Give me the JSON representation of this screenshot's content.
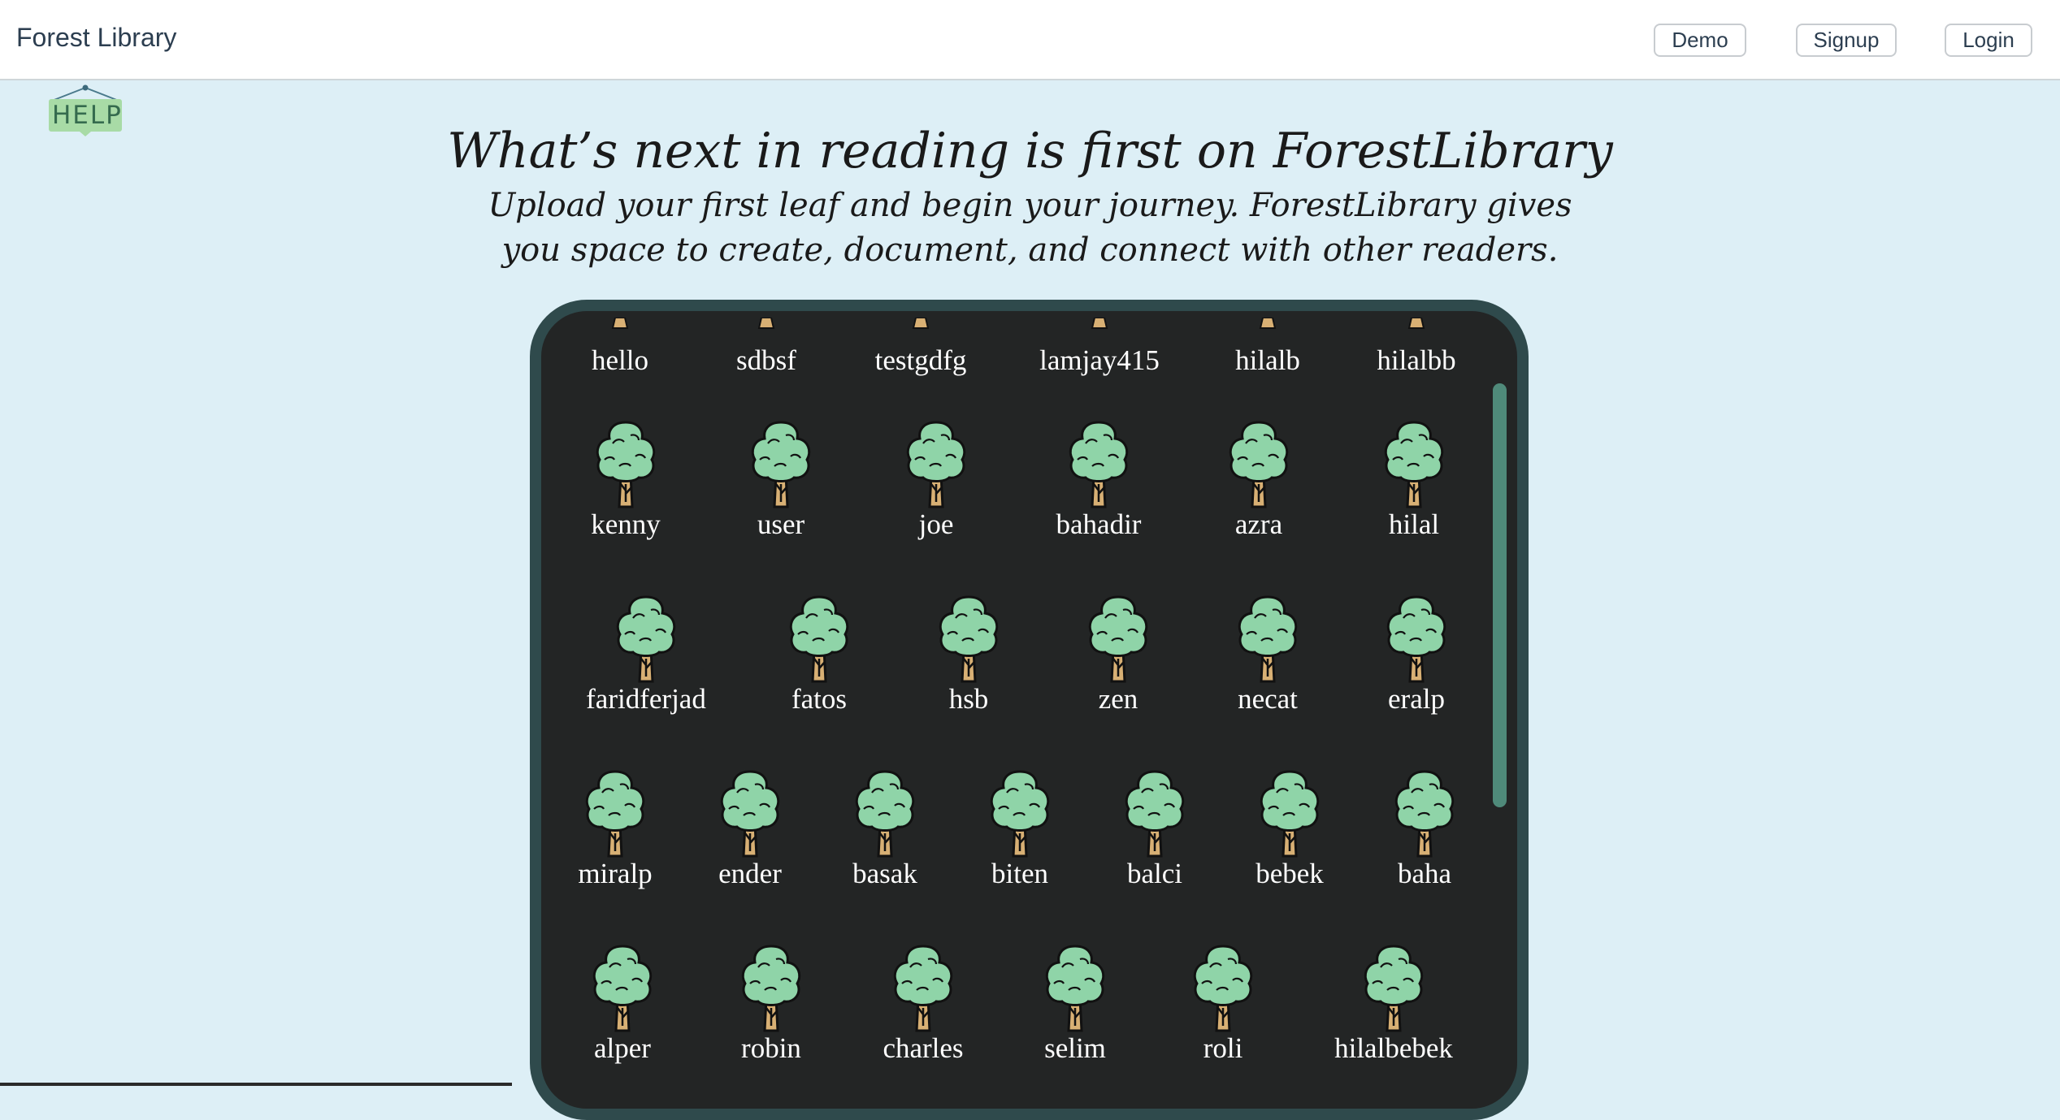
{
  "navbar": {
    "brand": "Forest Library",
    "buttons": {
      "demo": "Demo",
      "signup": "Signup",
      "login": "Login"
    }
  },
  "help": {
    "label": "HELP"
  },
  "hero": {
    "title": "What’s next in reading is first on ForestLibrary",
    "subtitle": "Upload your first leaf and begin your journey. ForestLibrary gives you space to create, document, and connect with other readers."
  },
  "forest": {
    "partial_row": [
      "hello",
      "sdbsf",
      "testgdfg",
      "lamjay415",
      "hilalb",
      "hilalbb"
    ],
    "rows": [
      [
        "kenny",
        "user",
        "joe",
        "bahadir",
        "azra",
        "hilal"
      ],
      [
        "faridferjad",
        "fatos",
        "hsb",
        "zen",
        "necat",
        "eralp"
      ],
      [
        "miralp",
        "ender",
        "basak",
        "biten",
        "balci",
        "bebek",
        "baha"
      ],
      [
        "alper",
        "robin",
        "charles",
        "selim",
        "roli",
        "hilalbebek"
      ]
    ]
  },
  "colors": {
    "page_bg": "#ddeff6",
    "panel_bg": "#232525",
    "panel_border": "#2f4a4c",
    "foliage": "#8fd4a8",
    "trunk": "#d8b074",
    "scrollbar": "#4f8a7a"
  }
}
